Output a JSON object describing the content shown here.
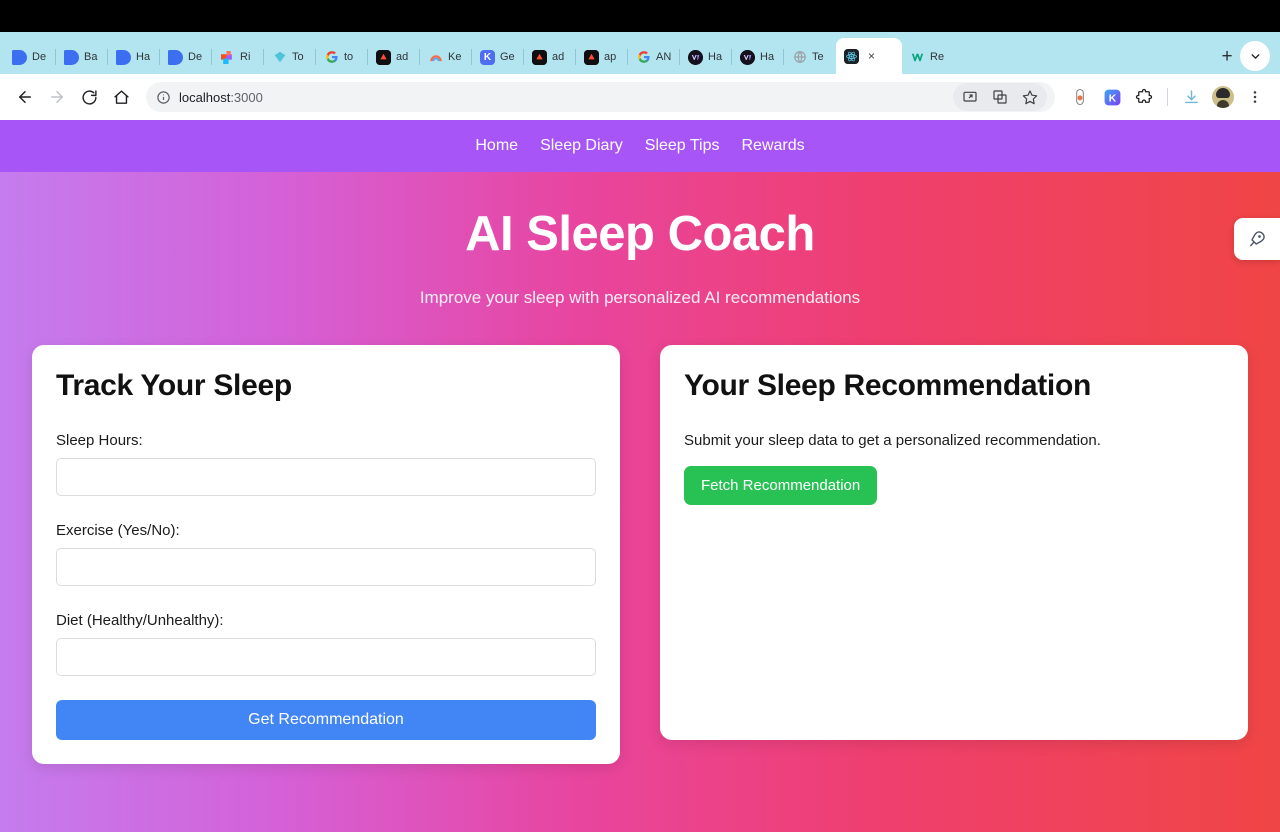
{
  "browser": {
    "tabs": [
      {
        "title": "De",
        "icon": "docs-icon",
        "style": "fv-blue",
        "glyph": "",
        "active": false
      },
      {
        "title": "Ba",
        "icon": "docs-icon",
        "style": "fv-blue",
        "glyph": "",
        "active": false
      },
      {
        "title": "Ha",
        "icon": "docs-icon",
        "style": "fv-blue",
        "glyph": "",
        "active": false
      },
      {
        "title": "De",
        "icon": "docs-icon",
        "style": "fv-blue",
        "glyph": "",
        "active": false
      },
      {
        "title": "Ri",
        "icon": "figma-icon",
        "style": "fv-figma",
        "glyph": "",
        "active": false
      },
      {
        "title": "To",
        "icon": "diamond-icon",
        "style": "fv-diamond",
        "glyph": "",
        "active": false
      },
      {
        "title": "to",
        "icon": "google-icon",
        "style": "fv-goog",
        "glyph": "G",
        "active": false
      },
      {
        "title": "ad",
        "icon": "vercel-icon",
        "style": "fv-dark",
        "glyph": "",
        "active": false
      },
      {
        "title": "Ke",
        "icon": "rainbow-icon",
        "style": "fv-rain",
        "glyph": "",
        "active": false
      },
      {
        "title": "Ge",
        "icon": "kaggle-icon",
        "style": "fv-kblue",
        "glyph": "K",
        "active": false
      },
      {
        "title": "ad",
        "icon": "vercel-icon",
        "style": "fv-dark",
        "glyph": "",
        "active": false
      },
      {
        "title": "ap",
        "icon": "vercel-icon",
        "style": "fv-dark",
        "glyph": "",
        "active": false
      },
      {
        "title": "AN",
        "icon": "google-icon",
        "style": "fv-goog",
        "glyph": "G",
        "active": false
      },
      {
        "title": "Ha",
        "icon": "vee-icon",
        "style": "fv-vee",
        "glyph": "",
        "active": false
      },
      {
        "title": "Ha",
        "icon": "vee-icon",
        "style": "fv-vee",
        "glyph": "",
        "active": false
      },
      {
        "title": "Te",
        "icon": "globe-icon",
        "style": "fv-globe",
        "glyph": "",
        "active": false
      },
      {
        "title": "",
        "icon": "react-icon",
        "style": "fv-react",
        "glyph": "",
        "active": true
      },
      {
        "title": "Re",
        "icon": "webflow-icon",
        "style": "fv-w",
        "glyph": "W",
        "active": false
      }
    ],
    "new_tab_label": "+",
    "close_label": "×",
    "url_host": "localhost",
    "url_port": ":3000"
  },
  "nav": {
    "items": [
      {
        "label": "Home"
      },
      {
        "label": "Sleep Diary"
      },
      {
        "label": "Sleep Tips"
      },
      {
        "label": "Rewards"
      }
    ]
  },
  "hero": {
    "title": "AI Sleep Coach",
    "subtitle": "Improve your sleep with personalized AI recommendations"
  },
  "track_card": {
    "title": "Track Your Sleep",
    "fields": [
      {
        "label": "Sleep Hours:",
        "value": "",
        "placeholder": ""
      },
      {
        "label": "Exercise (Yes/No):",
        "value": "",
        "placeholder": ""
      },
      {
        "label": "Diet (Healthy/Unhealthy):",
        "value": "",
        "placeholder": ""
      }
    ],
    "submit_label": "Get Recommendation"
  },
  "recommendation_card": {
    "title": "Your Sleep Recommendation",
    "body": "Submit your sleep data to get a personalized recommendation.",
    "fetch_label": "Fetch Recommendation"
  },
  "floating": {
    "icon": "rocket-icon"
  },
  "colors": {
    "nav_purple": "#a855f7",
    "gradient_start": "#c47cee",
    "gradient_end": "#f04545",
    "primary_button": "#4285f4",
    "success_button": "#28c154",
    "tabstrip": "#b3e5f0"
  }
}
